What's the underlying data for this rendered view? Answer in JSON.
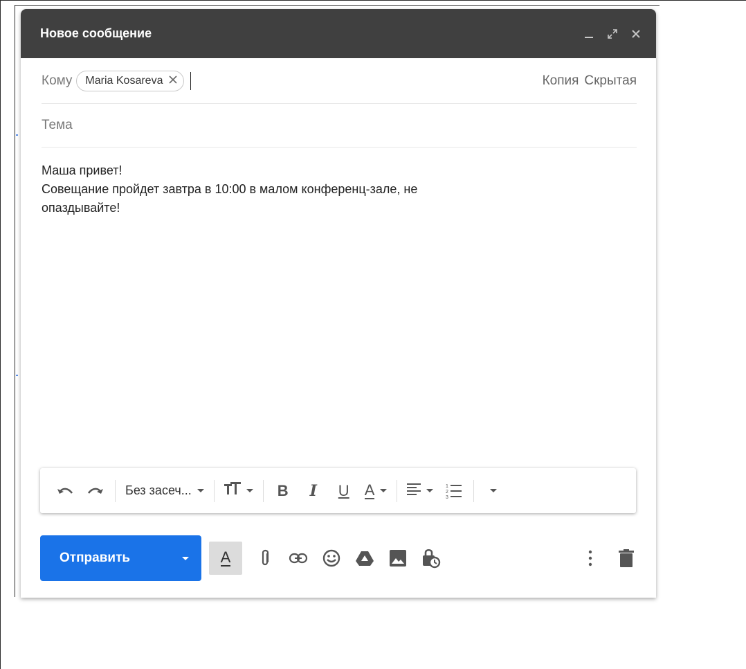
{
  "compose": {
    "title": "Новое сообщение",
    "header_icons": [
      "minimize-icon",
      "fullscreen-icon",
      "close-icon"
    ],
    "to_label": "Кому",
    "recipient": "Maria Kosareva",
    "cc_label": "Копия",
    "bcc_label": "Скрытая",
    "subject_placeholder": "Тема",
    "subject_value": "",
    "body_lines": [
      "Маша привет!",
      "Совещание пройдет завтра в 10:00 в малом конференц-зале, не",
      "опаздывайте!"
    ]
  },
  "toolbar": {
    "font_label": "Без засеч...",
    "bold_label": "B",
    "italic_label": "I",
    "underline_label": "U",
    "text_color_label": "A",
    "icons": [
      "undo-icon",
      "redo-icon",
      "font-size-icon",
      "align-icon",
      "numbered-list-icon",
      "more-formatting-icon"
    ]
  },
  "bottom": {
    "send_label": "Отправить",
    "format_toggle_label": "A",
    "icons": [
      "attach-icon",
      "link-icon",
      "emoji-icon",
      "drive-icon",
      "photo-icon",
      "confidential-mode-icon",
      "more-options-icon",
      "discard-icon"
    ]
  },
  "colors": {
    "header_bg": "#404040",
    "send_button": "#1a73e8"
  }
}
